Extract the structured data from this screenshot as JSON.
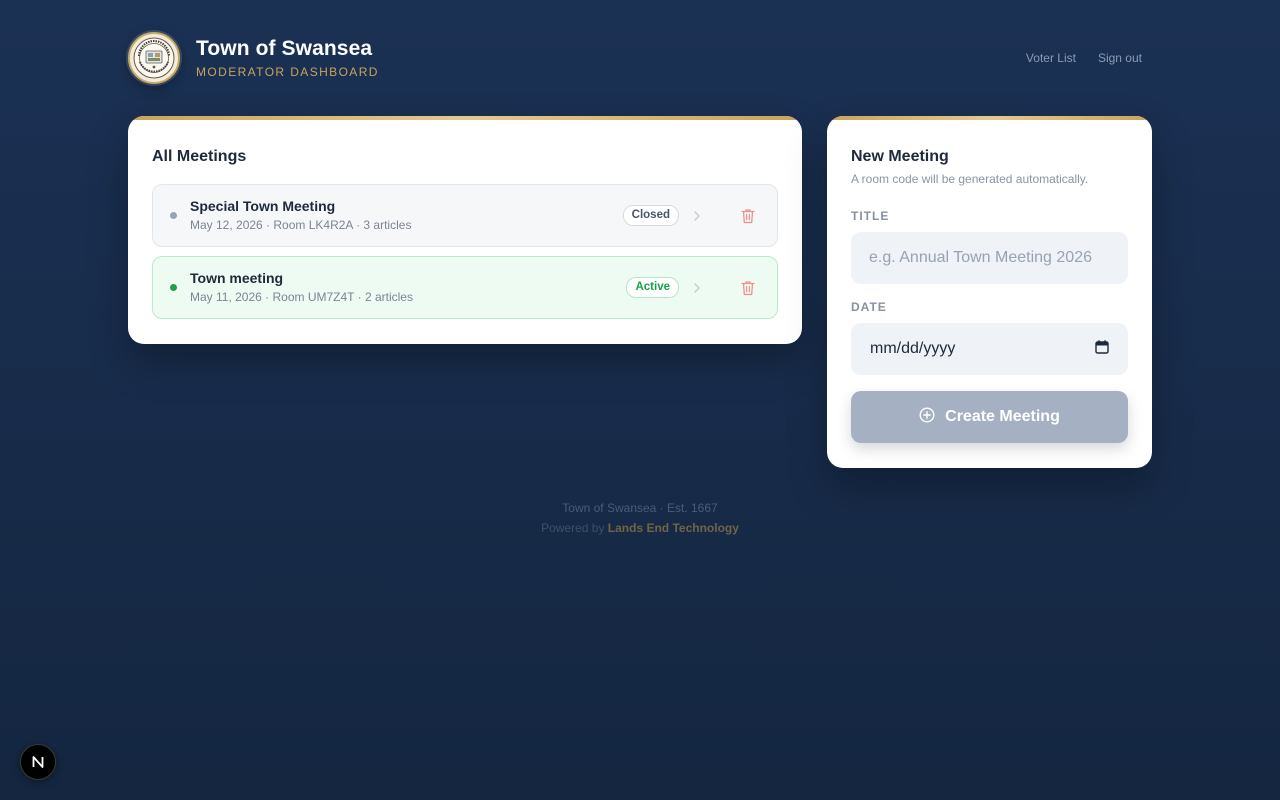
{
  "header": {
    "title": "Town of Swansea",
    "subtitle": "MODERATOR DASHBOARD",
    "seal_icon": "town-seal-logo",
    "nav": {
      "voter_list": "Voter List",
      "sign_out": "Sign out"
    }
  },
  "meetings": {
    "title": "All Meetings",
    "items": [
      {
        "name": "Special Town Meeting",
        "meta": "May 12, 2026 · Room LK4R2A · 3 articles",
        "status": "Closed"
      },
      {
        "name": "Town meeting",
        "meta": "May 11, 2026 · Room UM7Z4T · 2 articles",
        "status": "Active"
      }
    ]
  },
  "new_meeting": {
    "title": "New Meeting",
    "subtitle": "A room code will be generated automatically.",
    "title_label": "TITLE",
    "title_placeholder": "e.g. Annual Town Meeting 2026",
    "title_value": "",
    "date_label": "DATE",
    "date_placeholder": "mm/dd/yyyy",
    "create_label": "Create Meeting"
  },
  "footer": {
    "line1": "Town of Swansea · Est. 1667",
    "powered_prefix": "Powered by",
    "powered_name": "Lands End Technology"
  },
  "dev_badge": {
    "letter": "N"
  },
  "colors": {
    "background": "#1b3154",
    "gold_accent": "#c9a35a",
    "active_green": "#16a34a",
    "delete_red": "#f0908a",
    "button_disabled": "#a5b1c2"
  }
}
